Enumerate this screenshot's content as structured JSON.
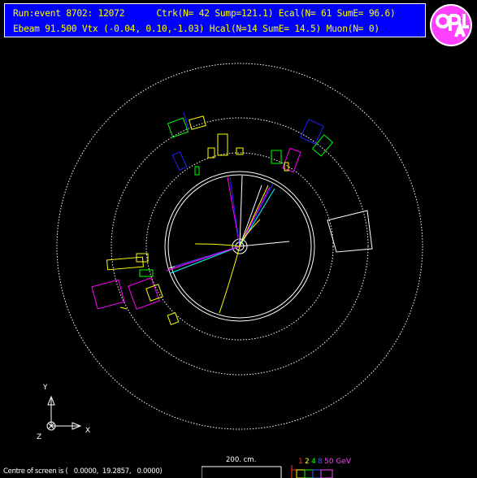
{
  "header": {
    "line1": "Run:event 8702: 12072      Ctrk(N= 42 Sump=121.1) Ecal(N= 61 SumE= 96.6)",
    "line2": "Ebeam 91.500 Vtx (-0.04, 0.10,-1.03) Hcal(N=14 SumE= 14.5) Muon(N= 0)"
  },
  "logo": {
    "text": "OPAL"
  },
  "axes": {
    "y_label": "Y",
    "x_label": "X",
    "z_label": "Z"
  },
  "footer": {
    "centre_text": "Centre of screen is (   0.0000,  19.2857,   0.0000)",
    "scale_label": "200. cm.",
    "energy_labels": [
      {
        "text": "1",
        "color": "#ff3030"
      },
      {
        "text": "2",
        "color": "#ffff00"
      },
      {
        "text": "4",
        "color": "#00ff00"
      },
      {
        "text": "8",
        "color": "#4060ff"
      },
      {
        "text": "50 GeV",
        "color": "#ff40ff"
      }
    ]
  },
  "colors": {
    "background": "#000000",
    "header_bg": "#0000ff",
    "header_text": "#ffff00",
    "track_yellow": "#ffff00",
    "ecal_magenta": "#ff00ff",
    "hcal_green": "#00ff00",
    "blue": "#2020ff"
  }
}
